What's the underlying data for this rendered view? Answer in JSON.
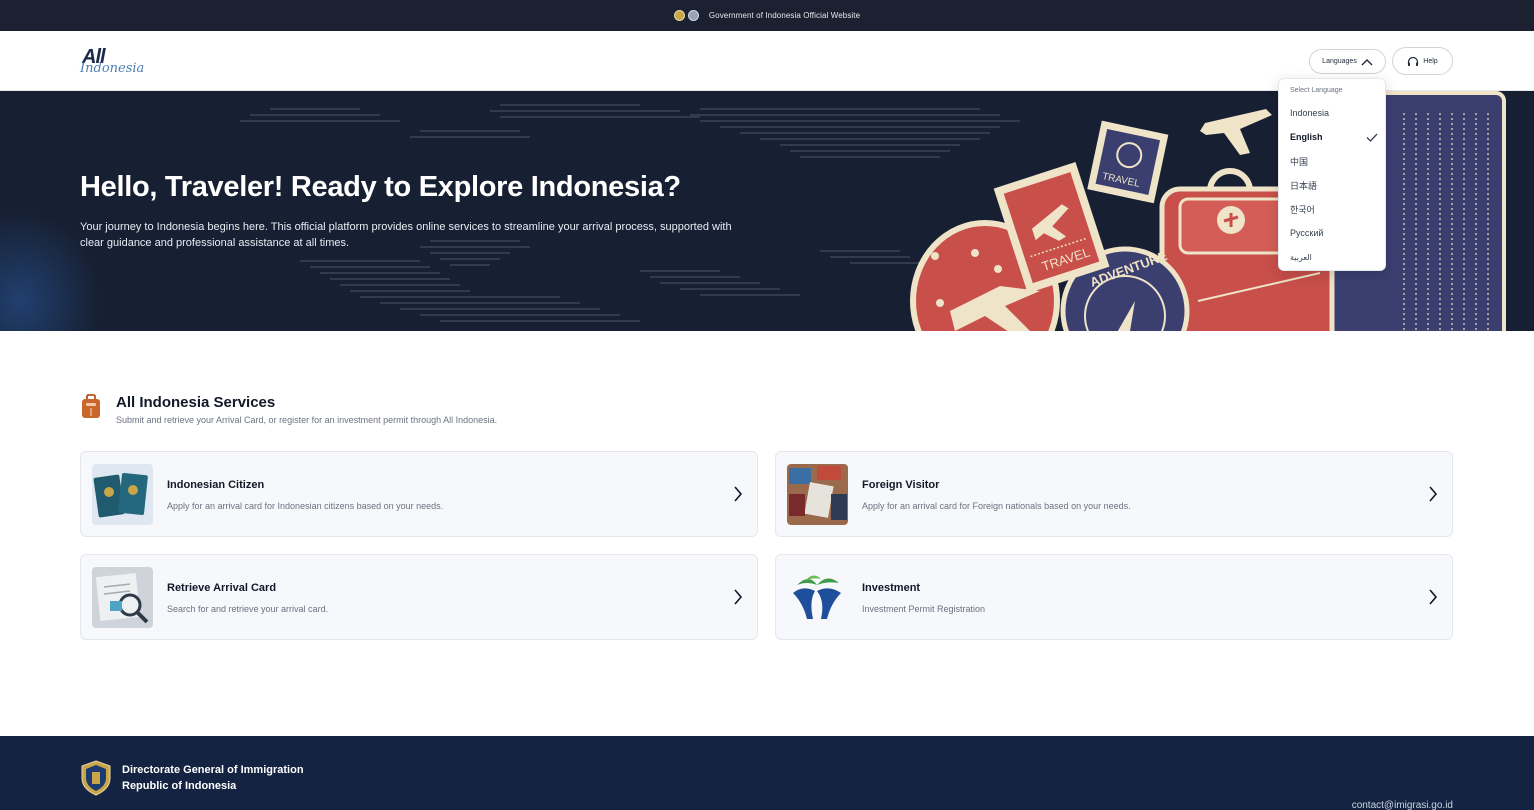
{
  "topbar": {
    "text": "Government of Indonesia Official Website"
  },
  "header": {
    "logo_line1": "All",
    "logo_line2": "Indonesia",
    "languages_label": "Languages",
    "help_label": "Help"
  },
  "language_menu": {
    "heading": "Select Language",
    "items": [
      {
        "label": "Indonesia",
        "selected": false
      },
      {
        "label": "English",
        "selected": true
      },
      {
        "label": "中国",
        "selected": false
      },
      {
        "label": "日本語",
        "selected": false
      },
      {
        "label": "한국어",
        "selected": false
      },
      {
        "label": "Русский",
        "selected": false
      },
      {
        "label": "العربية",
        "selected": false
      }
    ]
  },
  "hero": {
    "title": "Hello, Traveler! Ready to Explore Indonesia?",
    "description": "Your journey to Indonesia begins here. This official platform provides online services to streamline your arrival process, supported with clear guidance and professional assistance at all times.",
    "stamp_travel_1": "TRAVEL",
    "stamp_travel_2": "TRAVEL",
    "stamp_adventure": "ADVENTURE"
  },
  "services": {
    "title": "All Indonesia Services",
    "subtitle": "Submit and retrieve your Arrival Card, or register for an investment permit through All Indonesia.",
    "cards": [
      {
        "title": "Indonesian Citizen",
        "description": "Apply for an arrival card for Indonesian citizens based on your needs."
      },
      {
        "title": "Foreign Visitor",
        "description": "Apply for an arrival card for Foreign nationals based on your needs."
      },
      {
        "title": "Retrieve Arrival Card",
        "description": "Search for and retrieve your arrival card."
      },
      {
        "title": "Investment",
        "description": "Investment Permit Registration"
      }
    ]
  },
  "footer": {
    "org_line1": "Directorate General of Immigration",
    "org_line2": "Republic of Indonesia",
    "contact": "contact@imigrasi.go.id"
  },
  "colors": {
    "topbar": "#1b2131",
    "hero_bg": "#172033",
    "footer_bg": "#142341",
    "accent_red": "#c94f4a",
    "accent_cream": "#efe3c8",
    "accent_navy": "#3a3f70"
  }
}
